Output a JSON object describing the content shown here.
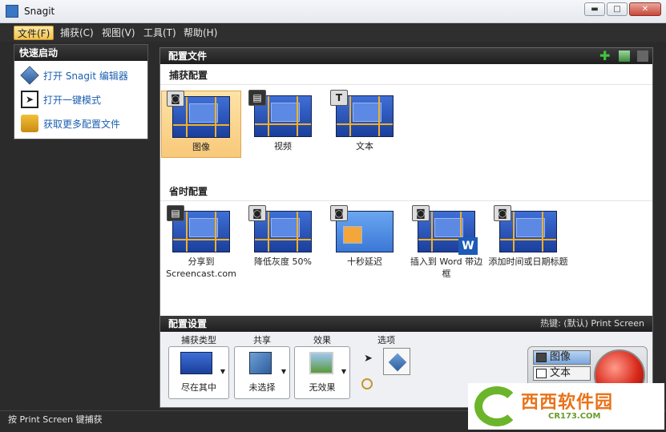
{
  "window": {
    "title": "Snagit"
  },
  "menu": [
    "文件(F)",
    "捕获(C)",
    "视图(V)",
    "工具(T)",
    "帮助(H)"
  ],
  "quick_launch": {
    "header": "快速启动",
    "items": [
      "打开 Snagit 编辑器",
      "打开一键模式",
      "获取更多配置文件"
    ]
  },
  "profiles": {
    "header": "配置文件",
    "capture_section": "捕获配置",
    "capture_items": [
      "图像",
      "视频",
      "文本"
    ],
    "timesaver_section": "省时配置",
    "timesaver_items": [
      "分享到 Screencast.com",
      "降低灰度 50%",
      "十秒延迟",
      "插入到 Word 带边框",
      "添加时间或日期标题"
    ]
  },
  "settings": {
    "header": "配置设置",
    "hotkey": "热键: (默认) Print Screen",
    "labels": {
      "type": "捕获类型",
      "share": "共享",
      "effects": "效果",
      "options": "选项"
    },
    "values": {
      "type": "尽在其中",
      "share": "未选择",
      "effects": "无效果"
    },
    "capture_modes": [
      "图像",
      "文本"
    ]
  },
  "status": "按 Print Screen 键捕获",
  "watermark": {
    "brand": "西西软件园",
    "url": "CR173.COM"
  },
  "colors": {
    "accent": "#f3c24d",
    "tile_selected": "#f8c97a",
    "capture_button": "#d8281a"
  }
}
